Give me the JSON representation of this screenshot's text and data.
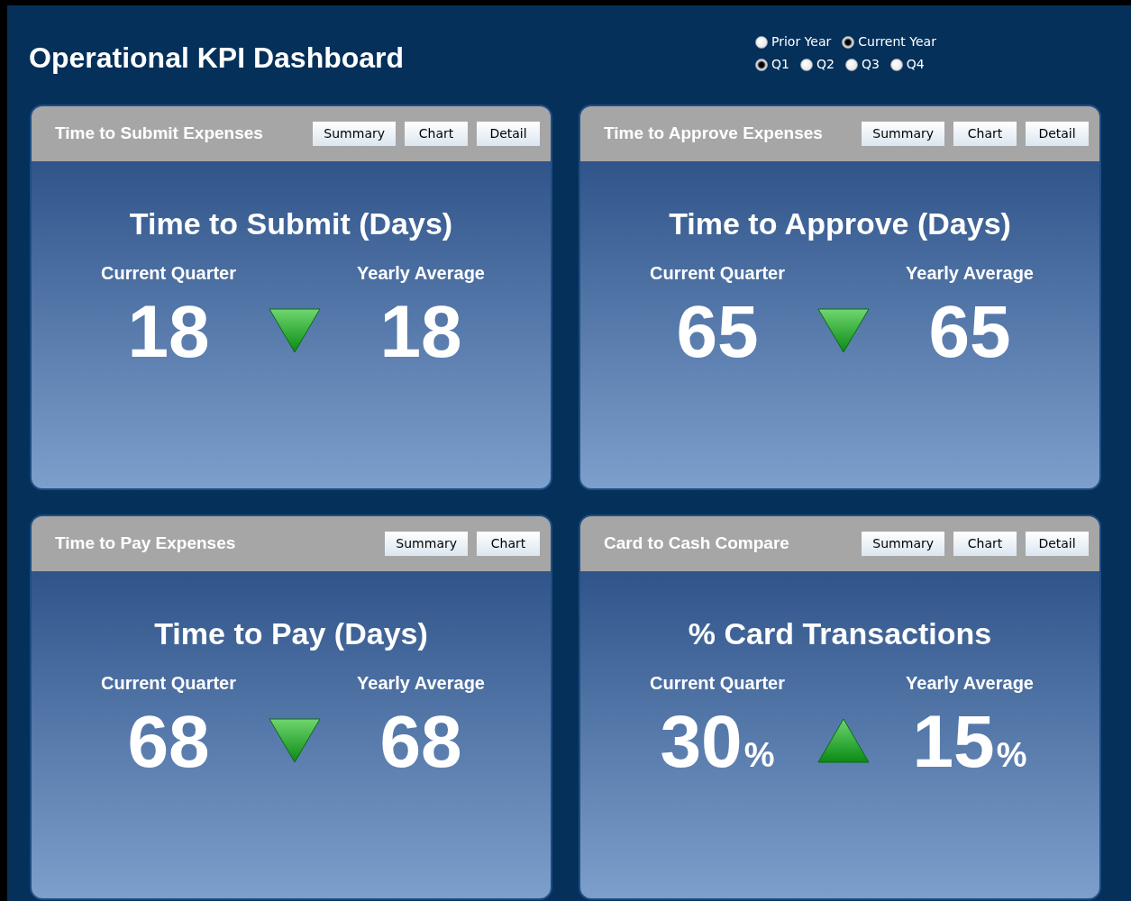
{
  "title": "Operational KPI Dashboard",
  "period": [
    {
      "label": "Prior Year",
      "selected": false
    },
    {
      "label": "Current Year",
      "selected": true
    }
  ],
  "quarters": [
    {
      "label": "Q1",
      "selected": true
    },
    {
      "label": "Q2",
      "selected": false
    },
    {
      "label": "Q3",
      "selected": false
    },
    {
      "label": "Q4",
      "selected": false
    }
  ],
  "cards": [
    {
      "header": "Time to Submit Expenses",
      "buttons": [
        "Summary",
        "Chart",
        "Detail"
      ],
      "heading": "Time to Submit (Days)",
      "current_label": "Current Quarter",
      "current": "18",
      "average_label": "Yearly Average",
      "average": "18",
      "kind": "down"
    },
    {
      "header": "Time to Approve Expenses",
      "buttons": [
        "Summary",
        "Chart",
        "Detail"
      ],
      "heading": "Time to Approve (Days)",
      "current_label": "Current Quarter",
      "current": "65",
      "average_label": "Yearly Average",
      "average": "65",
      "kind": "down"
    },
    {
      "header": "Time to Pay Expenses",
      "buttons": [
        "Summary",
        "Chart"
      ],
      "heading": "Time to Pay (Days)",
      "current_label": "Current Quarter",
      "current": "68",
      "average_label": "Yearly Average",
      "average": "68",
      "kind": "down"
    },
    {
      "header": "Card to Cash Compare",
      "buttons": [
        "Summary",
        "Chart",
        "Detail"
      ],
      "heading": "% Card Transactions",
      "current_label": "Current Quarter",
      "current": "30",
      "current_unit": "%",
      "average_label": "Yearly Average",
      "average": "15",
      "average_unit": "%",
      "kind": "up"
    }
  ]
}
